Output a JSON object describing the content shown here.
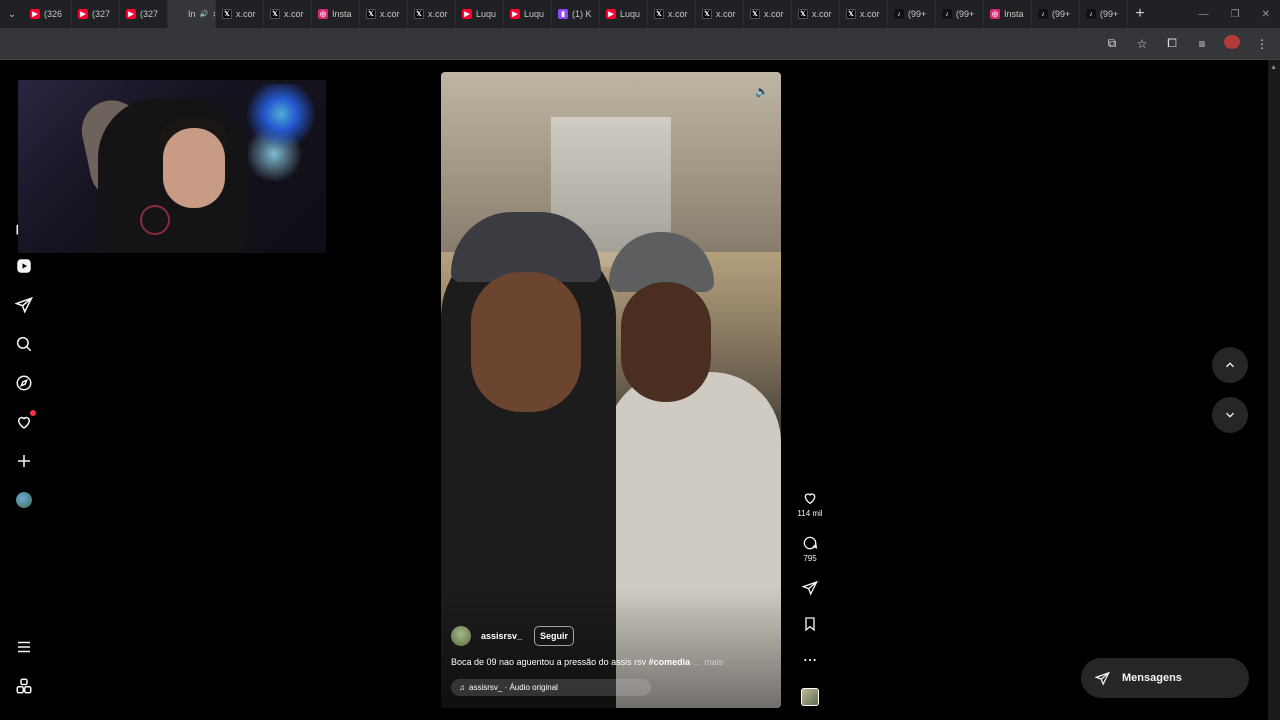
{
  "browser": {
    "tabs": [
      {
        "icon": "youtube-icon",
        "label": "(326"
      },
      {
        "icon": "youtube-icon",
        "label": "(327"
      },
      {
        "icon": "youtube-icon",
        "label": "(327"
      },
      {
        "icon": "in-icon",
        "label": "In",
        "active": true
      },
      {
        "icon": "x-icon",
        "label": "x.cor"
      },
      {
        "icon": "x-icon",
        "label": "x.cor"
      },
      {
        "icon": "instagram-icon",
        "label": "Insta"
      },
      {
        "icon": "x-icon",
        "label": "x.cor"
      },
      {
        "icon": "x-icon",
        "label": "x.cor"
      },
      {
        "icon": "youtube-icon",
        "label": "Luqu"
      },
      {
        "icon": "youtube-icon",
        "label": "Luqu"
      },
      {
        "icon": "twitch-icon",
        "label": "(1) K"
      },
      {
        "icon": "youtube-icon",
        "label": "Luqu"
      },
      {
        "icon": "x-icon",
        "label": "x.cor"
      },
      {
        "icon": "x-icon",
        "label": "x.cor"
      },
      {
        "icon": "x-icon",
        "label": "x.cor"
      },
      {
        "icon": "x-icon",
        "label": "x.cor"
      },
      {
        "icon": "x-icon",
        "label": "x.cor"
      },
      {
        "icon": "tiktok-icon",
        "label": "(99+"
      },
      {
        "icon": "tiktok-icon",
        "label": "(99+"
      },
      {
        "icon": "instagram-icon",
        "label": "Insta"
      },
      {
        "icon": "tiktok-icon",
        "label": "(99+"
      },
      {
        "icon": "tiktok-icon",
        "label": "(99+"
      }
    ],
    "new_tab_label": "+"
  },
  "reel": {
    "username": "assisrsv_",
    "follow_label": "Seguir",
    "caption_text": "Boca de 09 nao aguentou a pressão do assis rsv ",
    "caption_hashtag": "#comedia",
    "caption_more": "… mais",
    "audio_label": "assisrsv_ · Áudio original"
  },
  "actions": {
    "likes": "114 mil",
    "comments": "795"
  },
  "messages_label": "Mensagens",
  "colors": {
    "background": "#000000",
    "surface": "#262626",
    "notification": "#ff3040"
  }
}
